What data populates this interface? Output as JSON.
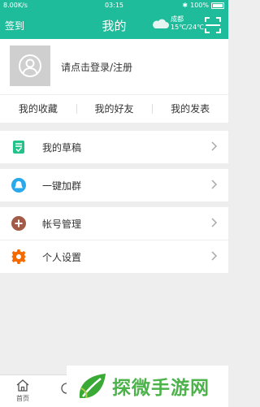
{
  "status_bar": {
    "network": "8.00K/s",
    "time": "03:15",
    "battery": "100%"
  },
  "header": {
    "left_action": "签到",
    "title": "我的",
    "weather": {
      "city": "成都",
      "temp": "15℃/24℃",
      "icon": "cloudy-icon"
    },
    "right_icon": "scan-icon"
  },
  "profile": {
    "login_prompt": "请点击登录/注册",
    "avatar_icon": "user-avatar-icon"
  },
  "tabs": [
    "我的收藏",
    "我的好友",
    "我的发表"
  ],
  "menu": {
    "drafts": {
      "label": "我的草稿",
      "icon": "draft-icon",
      "color": "#21c38a"
    },
    "join_group": {
      "label": "一键加群",
      "icon": "chat-bubble-icon",
      "color": "#29a8eb"
    },
    "account": {
      "label": "帐号管理",
      "icon": "plus-icon",
      "color": "#a15b47"
    },
    "settings": {
      "label": "个人设置",
      "icon": "gear-icon",
      "color": "#f56a00"
    }
  },
  "bottom_nav": [
    {
      "label": "首页",
      "icon": "home-icon"
    }
  ],
  "watermark": {
    "text": "探微手游网"
  },
  "colors": {
    "primary": "#1fbc9c",
    "background": "#eeeeee"
  }
}
